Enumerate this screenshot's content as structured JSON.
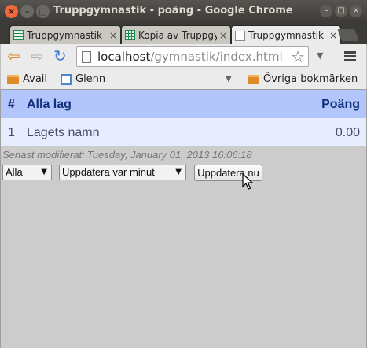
{
  "window": {
    "title": "Truppgymnastik - poäng - Google Chrome"
  },
  "tabs": [
    {
      "label": "Truppgymnastik",
      "icon": "spreadsheet-icon",
      "active": false
    },
    {
      "label": "Kopia av Truppgym",
      "icon": "spreadsheet-icon",
      "active": false
    },
    {
      "label": "Truppgymnastik",
      "icon": "document-icon",
      "active": true
    }
  ],
  "toolbar": {
    "url_host": "localhost",
    "url_path": "/gymnastik/index.html"
  },
  "bookmarks": {
    "items": [
      "Avail",
      "Glenn"
    ],
    "other": "Övriga bokmärken"
  },
  "table": {
    "headers": {
      "num": "#",
      "team": "Alla lag",
      "score": "Poäng"
    },
    "rows": [
      {
        "num": "1",
        "team": "Lagets namn",
        "score": "0.00"
      }
    ]
  },
  "status": {
    "modified_label": "Senast modifierat:",
    "modified_value": "Tuesday, January 01, 2013 16:06:18"
  },
  "controls": {
    "filter_value": "Alla",
    "interval_value": "Uppdatera var minut",
    "update_button": "Uppdatera nu"
  },
  "colors": {
    "header_bg": "#b3c6fb",
    "header_text": "#12317d",
    "row_bg": "#e7ecfe",
    "page_bg": "#cccccc"
  }
}
